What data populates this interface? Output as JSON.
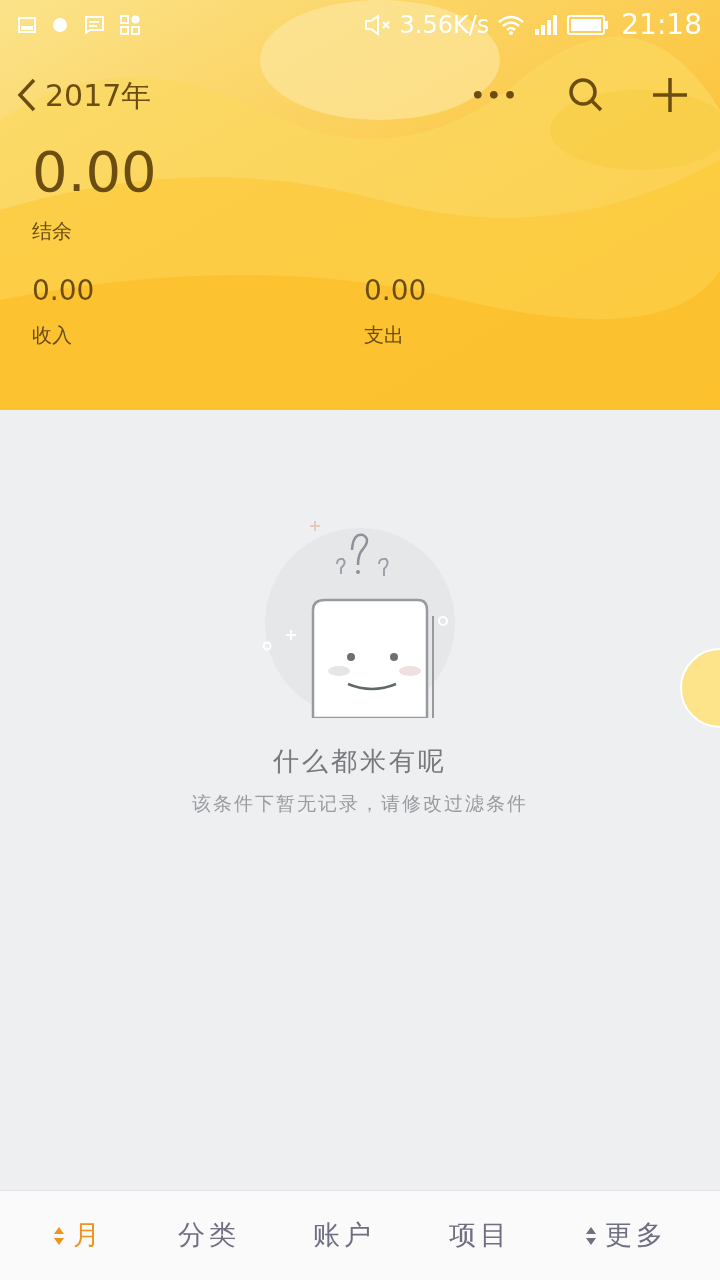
{
  "status_bar": {
    "speed": "3.56K/s",
    "time": "21:18"
  },
  "header": {
    "back_label": "2017年",
    "more_label": "•••"
  },
  "balance": {
    "amount": "0.00",
    "label": "结余"
  },
  "totals": [
    {
      "amount": "0.00",
      "label": "收入"
    },
    {
      "amount": "0.00",
      "label": "支出"
    }
  ],
  "empty_state": {
    "title": "什么都米有呢",
    "hint": "该条件下暂无记录，请修改过滤条件"
  },
  "tabs": [
    {
      "label": "月",
      "selected": true,
      "sortable": true
    },
    {
      "label": "分类",
      "selected": false,
      "sortable": false
    },
    {
      "label": "账户",
      "selected": false,
      "sortable": false
    },
    {
      "label": "项目",
      "selected": false,
      "sortable": false
    },
    {
      "label": "更多",
      "selected": false,
      "sortable": true
    }
  ]
}
